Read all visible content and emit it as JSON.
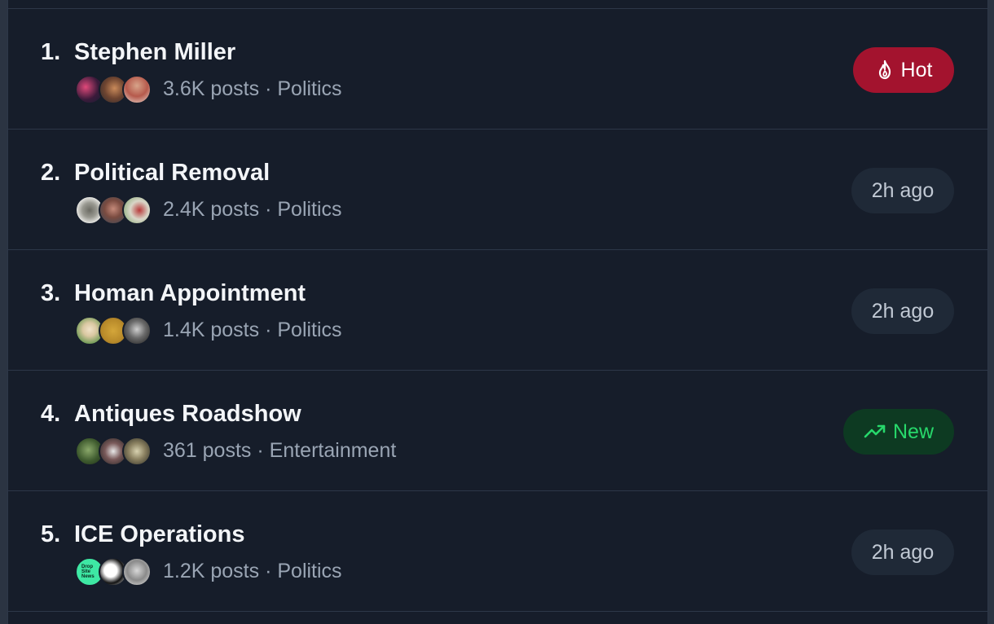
{
  "trending": [
    {
      "rank": "1.",
      "title": "Stephen Miller",
      "posts": "3.6K posts",
      "separator": "·",
      "category": "Politics",
      "badge": {
        "type": "hot",
        "label": "Hot",
        "icon": "flame-icon"
      }
    },
    {
      "rank": "2.",
      "title": "Political Removal",
      "posts": "2.4K posts",
      "separator": "·",
      "category": "Politics",
      "badge": {
        "type": "ago",
        "label": "2h ago"
      }
    },
    {
      "rank": "3.",
      "title": "Homan Appointment",
      "posts": "1.4K posts",
      "separator": "·",
      "category": "Politics",
      "badge": {
        "type": "ago",
        "label": "2h ago"
      }
    },
    {
      "rank": "4.",
      "title": "Antiques Roadshow",
      "posts": "361 posts",
      "separator": "·",
      "category": "Entertainment",
      "badge": {
        "type": "new",
        "label": "New",
        "icon": "trending-up-icon"
      }
    },
    {
      "rank": "5.",
      "title": "ICE Operations",
      "posts": "1.2K posts",
      "separator": "·",
      "category": "Politics",
      "badge": {
        "type": "ago",
        "label": "2h ago"
      }
    }
  ],
  "avatar_text": {
    "drop_site_news": "Drop Site News"
  },
  "colors": {
    "background": "#161d2a",
    "hot": "#a3132e",
    "new_bg": "#0d3a22",
    "new_text": "#27d86b",
    "ago_bg": "#1f2937"
  }
}
